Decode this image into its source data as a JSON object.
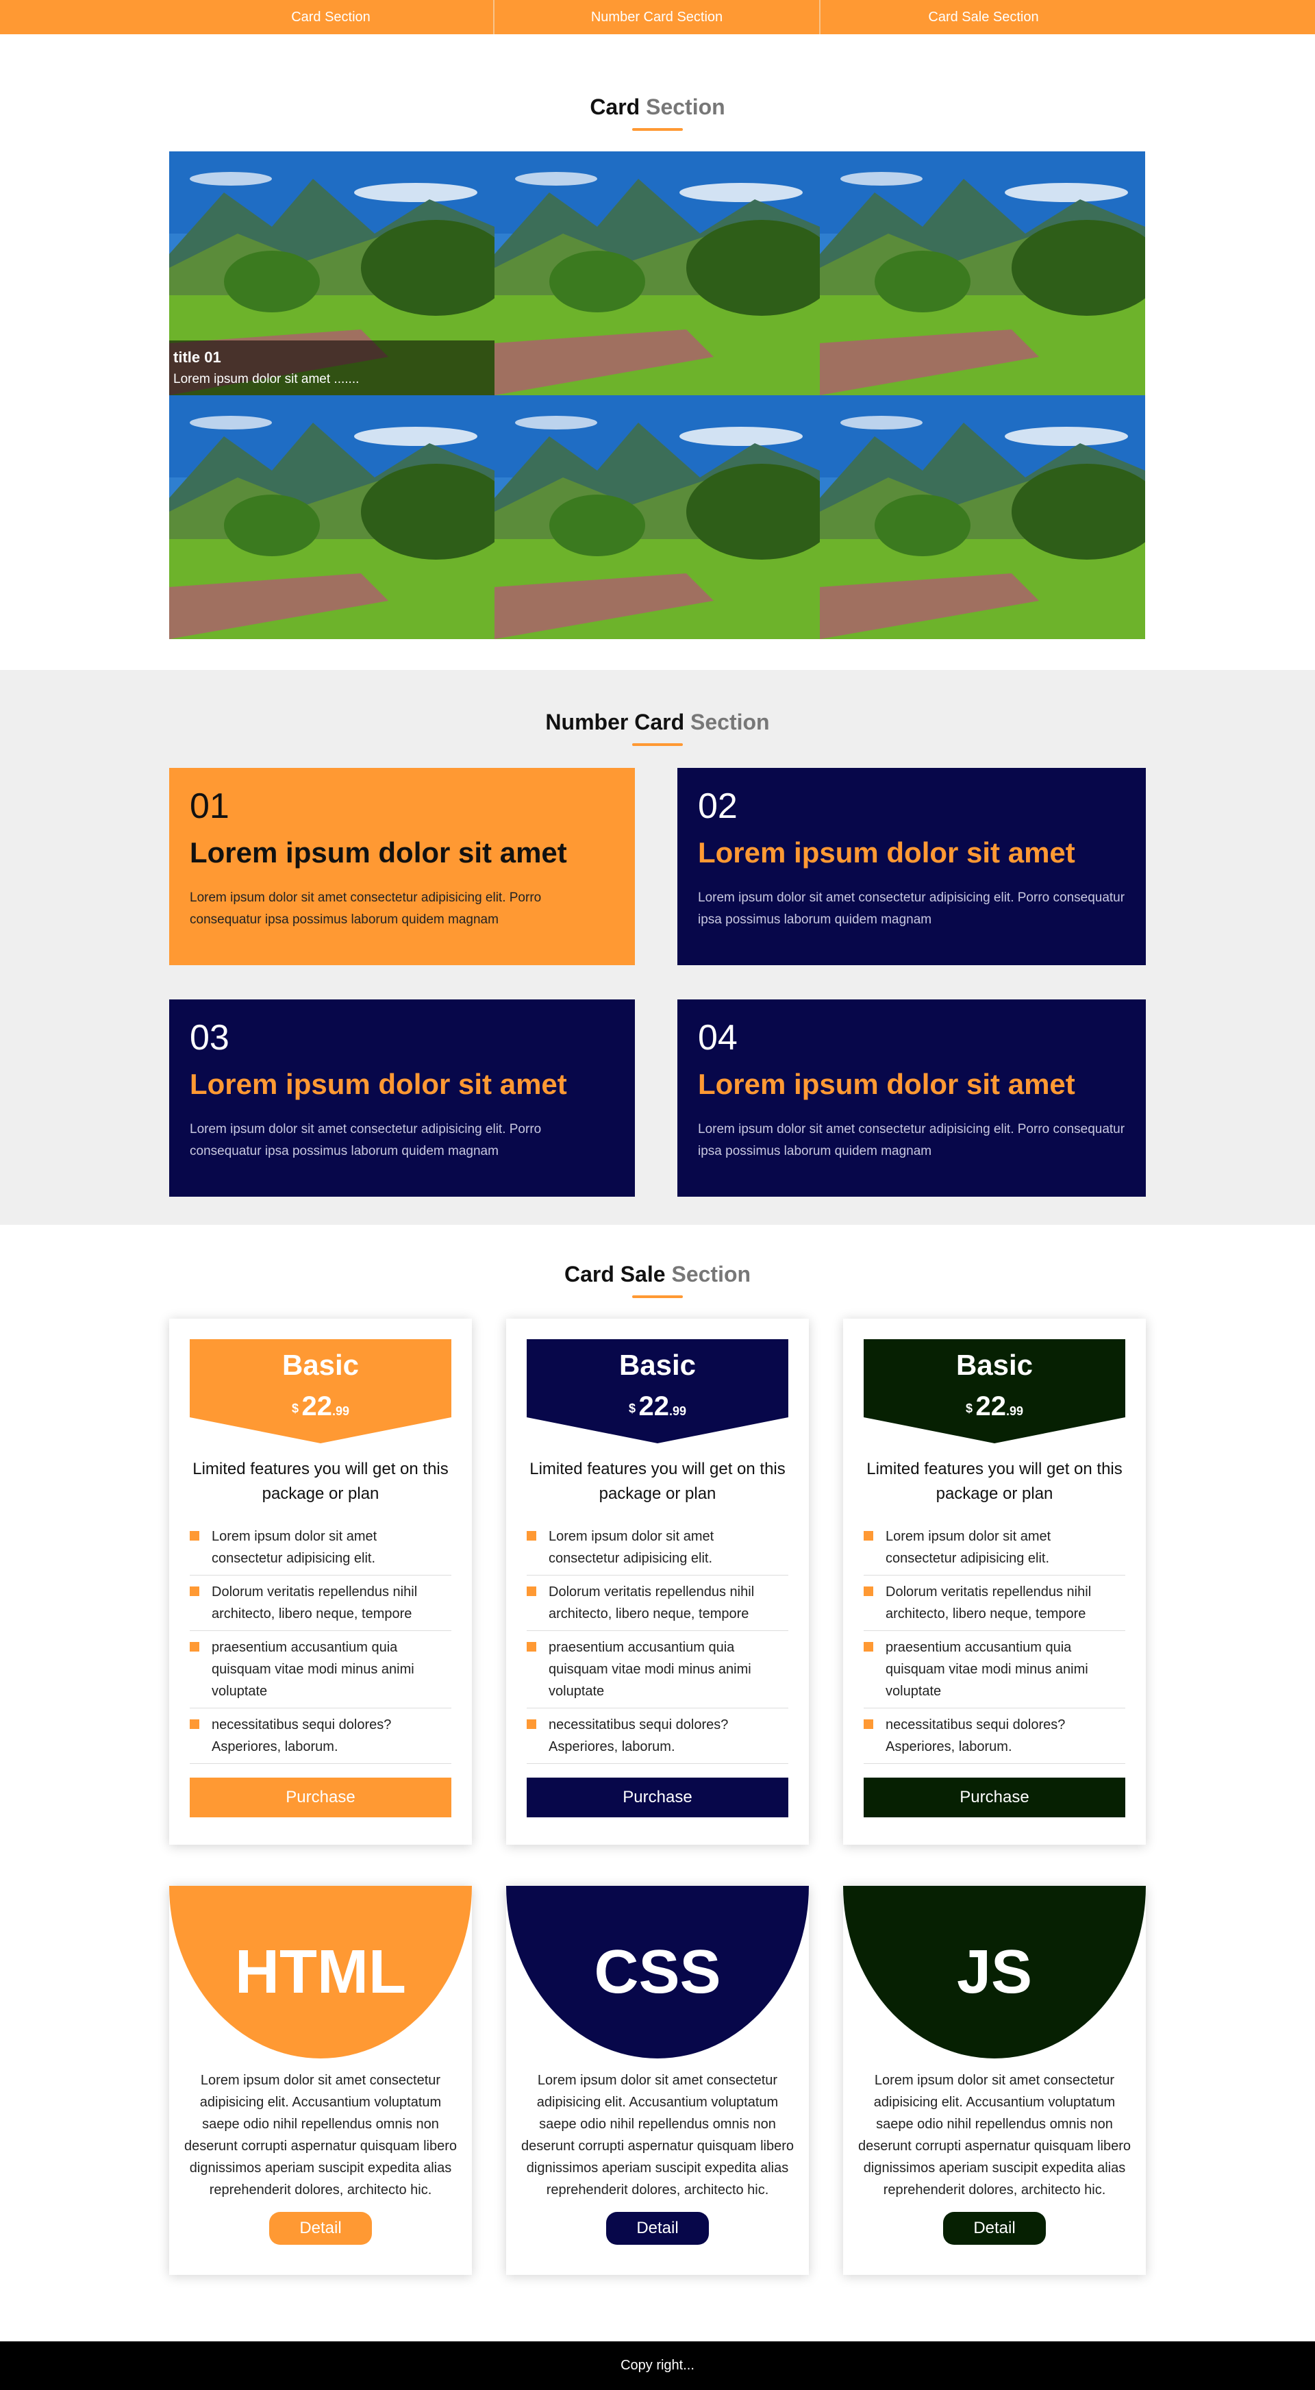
{
  "nav": {
    "items": [
      "Card Section",
      "Number Card Section",
      "Card Sale Section"
    ]
  },
  "card_section": {
    "title_bold": "Card",
    "title_muted": "Section",
    "tiles": [
      {
        "caption_title": "title 01",
        "caption_text": "Lorem ipsum dolor sit amet ......."
      },
      {},
      {},
      {},
      {},
      {}
    ]
  },
  "number_section": {
    "title_bold": "Number Card",
    "title_muted": "Section",
    "cards": [
      {
        "num": "01",
        "title": "Lorem ipsum dolor sit amet",
        "text": "Lorem ipsum dolor sit amet consectetur adipisicing elit. Porro consequatur ipsa possimus laborum quidem magnam",
        "style": "orange"
      },
      {
        "num": "02",
        "title": "Lorem ipsum dolor sit amet",
        "text": "Lorem ipsum dolor sit amet consectetur adipisicing elit. Porro consequatur ipsa possimus laborum quidem magnam",
        "style": "navy"
      },
      {
        "num": "03",
        "title": "Lorem ipsum dolor sit amet",
        "text": "Lorem ipsum dolor sit amet consectetur adipisicing elit. Porro consequatur ipsa possimus laborum quidem magnam",
        "style": "navy"
      },
      {
        "num": "04",
        "title": "Lorem ipsum dolor sit amet",
        "text": "Lorem ipsum dolor sit amet consectetur adipisicing elit. Porro consequatur ipsa possimus laborum quidem magnam",
        "style": "navy"
      }
    ]
  },
  "sale_section": {
    "title_bold": "Card Sale",
    "title_muted": "Section",
    "price_cards": [
      {
        "color": "#ff9933",
        "title": "Basic",
        "currency": "$",
        "amount": "22",
        "cents": ".99",
        "description": "Limited features you will get on this package or plan",
        "features": [
          "Lorem ipsum dolor sit amet consectetur adipisicing elit.",
          "Dolorum veritatis repellendus nihil architecto, libero neque, tempore",
          "praesentium accusantium quia quisquam vitae modi minus animi voluptate",
          "necessitatibus sequi dolores? Asperiores, laborum."
        ],
        "button": "Purchase"
      },
      {
        "color": "#07074a",
        "title": "Basic",
        "currency": "$",
        "amount": "22",
        "cents": ".99",
        "description": "Limited features you will get on this package or plan",
        "features": [
          "Lorem ipsum dolor sit amet consectetur adipisicing elit.",
          "Dolorum veritatis repellendus nihil architecto, libero neque, tempore",
          "praesentium accusantium quia quisquam vitae modi minus animi voluptate",
          "necessitatibus sequi dolores? Asperiores, laborum."
        ],
        "button": "Purchase"
      },
      {
        "color": "#062002",
        "title": "Basic",
        "currency": "$",
        "amount": "22",
        "cents": ".99",
        "description": "Limited features you will get on this package or plan",
        "features": [
          "Lorem ipsum dolor sit amet consectetur adipisicing elit.",
          "Dolorum veritatis repellendus nihil architecto, libero neque, tempore",
          "praesentium accusantium quia quisquam vitae modi minus animi voluptate",
          "necessitatibus sequi dolores? Asperiores, laborum."
        ],
        "button": "Purchase"
      }
    ],
    "tech_cards": [
      {
        "color": "#ff9933",
        "label": "HTML",
        "text": "Lorem ipsum dolor sit amet consectetur adipisicing elit. Accusantium voluptatum saepe odio nihil repellendus omnis non deserunt corrupti aspernatur quisquam libero dignissimos aperiam suscipit expedita alias reprehenderit dolores, architecto hic.",
        "button": "Detail"
      },
      {
        "color": "#07074a",
        "label": "CSS",
        "text": "Lorem ipsum dolor sit amet consectetur adipisicing elit. Accusantium voluptatum saepe odio nihil repellendus omnis non deserunt corrupti aspernatur quisquam libero dignissimos aperiam suscipit expedita alias reprehenderit dolores, architecto hic.",
        "button": "Detail"
      },
      {
        "color": "#062002",
        "label": "JS",
        "text": "Lorem ipsum dolor sit amet consectetur adipisicing elit. Accusantium voluptatum saepe odio nihil repellendus omnis non deserunt corrupti aspernatur quisquam libero dignissimos aperiam suscipit expedita alias reprehenderit dolores, architecto hic.",
        "button": "Detail"
      }
    ]
  },
  "footer": {
    "text": "Copy right..."
  },
  "colors": {
    "accent": "#ff9933",
    "navy": "#07074a",
    "dark_green": "#062002"
  }
}
